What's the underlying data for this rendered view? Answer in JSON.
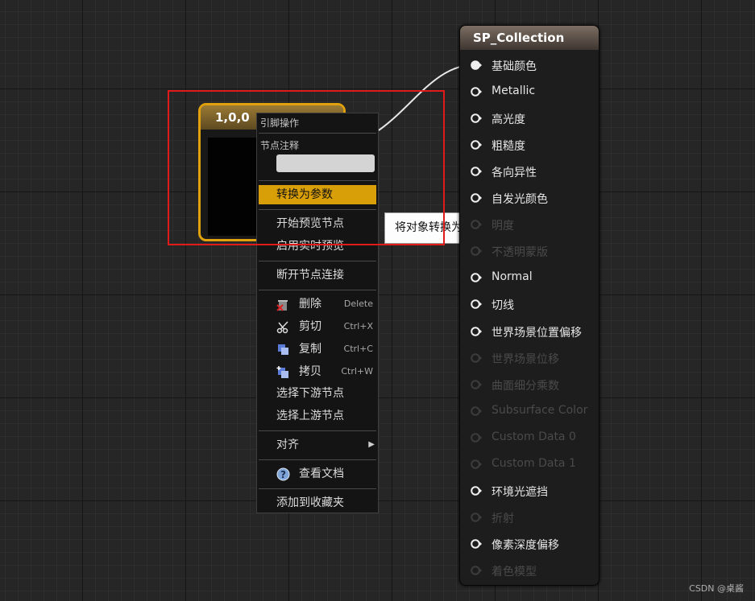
{
  "constant_node": {
    "title": "1,0,0"
  },
  "context_menu": {
    "section_pin_actions": "引脚操作",
    "section_node_comment": "节点注释",
    "comment_value": "",
    "items": {
      "convert_to_param": "转换为参数",
      "start_preview": "开始预览节点",
      "enable_realtime": "启用实时预览",
      "break_links": "断开节点连接",
      "delete": "删除",
      "cut": "剪切",
      "copy": "复制",
      "duplicate": "拷贝",
      "select_downstream": "选择下游节点",
      "select_upstream": "选择上游节点",
      "align": "对齐",
      "view_docs": "查看文档",
      "add_favorites": "添加到收藏夹"
    },
    "shortcuts": {
      "delete": "Delete",
      "cut": "Ctrl+X",
      "copy": "Ctrl+C",
      "duplicate": "Ctrl+W"
    },
    "highlight_color": "#d99f08"
  },
  "tooltip": {
    "text": "将对象转换为参数。"
  },
  "material_node": {
    "title": "SP_Collection",
    "pins": [
      {
        "label": "基础颜色",
        "enabled": true,
        "connected": true
      },
      {
        "label": "Metallic",
        "enabled": true,
        "connected": false
      },
      {
        "label": "高光度",
        "enabled": true,
        "connected": false
      },
      {
        "label": "粗糙度",
        "enabled": true,
        "connected": false
      },
      {
        "label": "各向异性",
        "enabled": true,
        "connected": false
      },
      {
        "label": "自发光颜色",
        "enabled": true,
        "connected": false
      },
      {
        "label": "明度",
        "enabled": false,
        "connected": false
      },
      {
        "label": "不透明蒙版",
        "enabled": false,
        "connected": false
      },
      {
        "label": "Normal",
        "enabled": true,
        "connected": false
      },
      {
        "label": "切线",
        "enabled": true,
        "connected": false
      },
      {
        "label": "世界场景位置偏移",
        "enabled": true,
        "connected": false
      },
      {
        "label": "世界场景位移",
        "enabled": false,
        "connected": false
      },
      {
        "label": "曲面细分乘数",
        "enabled": false,
        "connected": false
      },
      {
        "label": "Subsurface Color",
        "enabled": false,
        "connected": false
      },
      {
        "label": "Custom Data 0",
        "enabled": false,
        "connected": false
      },
      {
        "label": "Custom Data 1",
        "enabled": false,
        "connected": false
      },
      {
        "label": "环境光遮挡",
        "enabled": true,
        "connected": false
      },
      {
        "label": "折射",
        "enabled": false,
        "connected": false
      },
      {
        "label": "像素深度偏移",
        "enabled": true,
        "connected": false
      },
      {
        "label": "着色模型",
        "enabled": false,
        "connected": false
      }
    ]
  },
  "watermark": "CSDN @桌酱",
  "colors": {
    "constant_node_border": "#e0a10c",
    "annotation_red": "#e01a1a",
    "wire": "#e8e8e8"
  }
}
